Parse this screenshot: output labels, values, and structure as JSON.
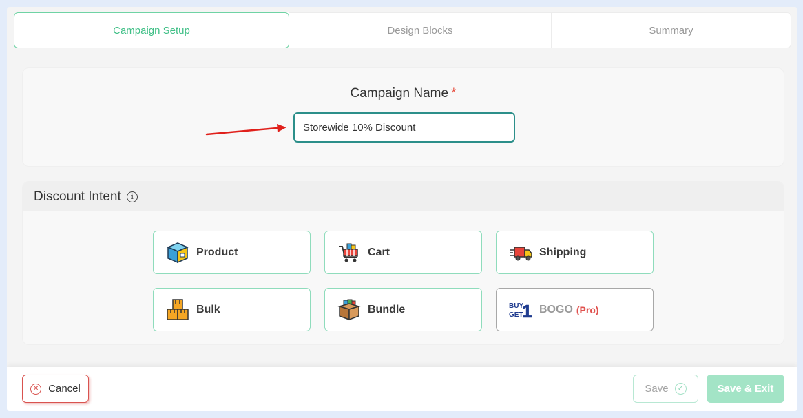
{
  "tabs": [
    {
      "label": "Campaign Setup",
      "active": true
    },
    {
      "label": "Design Blocks",
      "active": false
    },
    {
      "label": "Summary",
      "active": false
    }
  ],
  "campaign": {
    "label": "Campaign Name",
    "required_mark": "*",
    "value": "Storewide 10% Discount"
  },
  "intent": {
    "title": "Discount Intent",
    "info_glyph": "i",
    "options": [
      {
        "label": "Product",
        "icon": "product-box-icon"
      },
      {
        "label": "Cart",
        "icon": "shopping-cart-icon"
      },
      {
        "label": "Shipping",
        "icon": "delivery-truck-icon"
      },
      {
        "label": "Bulk",
        "icon": "stacked-boxes-icon"
      },
      {
        "label": "Bundle",
        "icon": "bundle-box-icon"
      },
      {
        "label": "BOGO",
        "icon": "buy-get-one-icon",
        "pro_tag": "(Pro)"
      }
    ]
  },
  "bogo_logo_text": {
    "line1": "BUY",
    "line2": "GET",
    "digit": "1"
  },
  "footer": {
    "cancel_label": "Cancel",
    "save_label": "Save",
    "save_exit_label": "Save & Exit"
  },
  "colors": {
    "accent_green": "#3fbf86",
    "input_border": "#2c8f8a",
    "danger": "#d9534f",
    "save_exit_bg": "#a3e4c6"
  }
}
